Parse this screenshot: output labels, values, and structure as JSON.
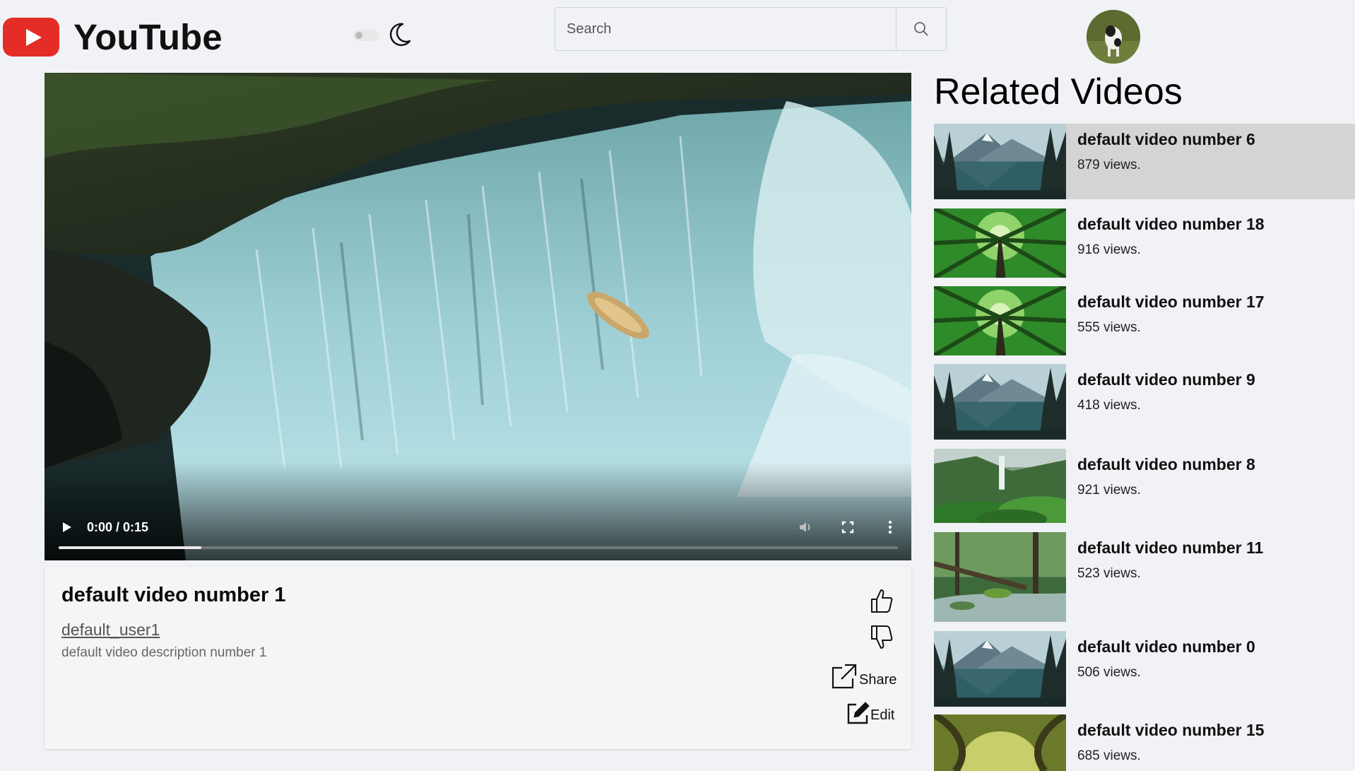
{
  "header": {
    "logo_text": "YouTube",
    "search_placeholder": "Search",
    "theme_icon": "moon-icon",
    "search_icon": "search-icon"
  },
  "player": {
    "time": "0:00 / 0:15",
    "progress": 0.17,
    "icons": [
      "play-icon",
      "volume-icon",
      "fullscreen-icon",
      "more-vert-icon"
    ]
  },
  "video": {
    "title": "default video number 1",
    "channel": "default_user1",
    "description": "default video description number 1",
    "share_label": "Share",
    "edit_label": "Edit"
  },
  "related": {
    "heading": "Related Videos",
    "items": [
      {
        "title": "default video number 6",
        "views": "879 views.",
        "thumb": "mountain-lake"
      },
      {
        "title": "default video number 18",
        "views": "916 views.",
        "thumb": "forest-canopy"
      },
      {
        "title": "default video number 17",
        "views": "555 views.",
        "thumb": "forest-canopy"
      },
      {
        "title": "default video number 9",
        "views": "418 views.",
        "thumb": "mountain-lake"
      },
      {
        "title": "default video number 8",
        "views": "921 views.",
        "thumb": "jungle-waterfall"
      },
      {
        "title": "default video number 11",
        "views": "523 views.",
        "thumb": "forest-stream"
      },
      {
        "title": "default video number 0",
        "views": "506 views.",
        "thumb": "mountain-lake"
      },
      {
        "title": "default video number 15",
        "views": "685 views.",
        "thumb": "tree-tunnel"
      }
    ]
  },
  "colors": {
    "brand_red": "#e52d27",
    "page_bg": "#f1f2f6",
    "active_item_bg": "#d4d4d4"
  }
}
